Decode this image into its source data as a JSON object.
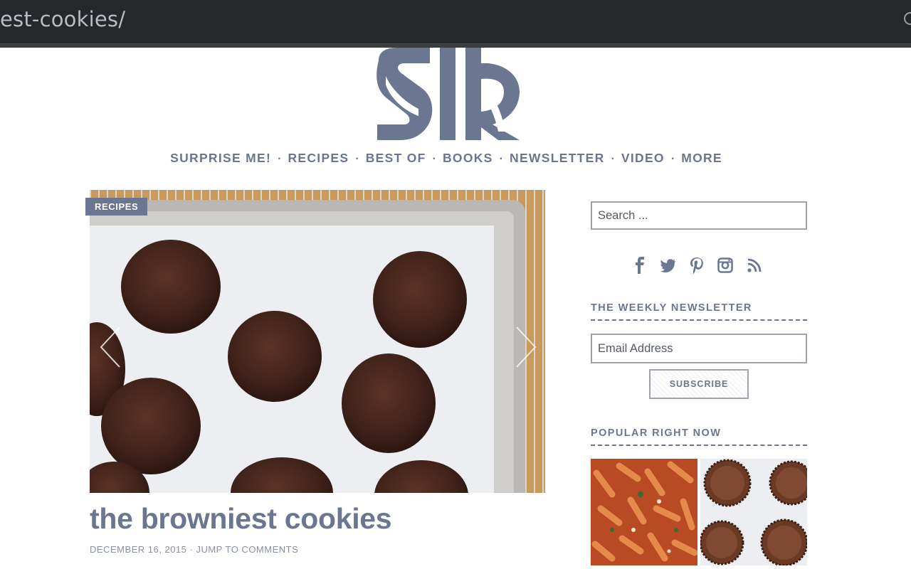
{
  "browser": {
    "url_fragment": "est-cookies/"
  },
  "nav": {
    "items": [
      "SURPRISE ME!",
      "RECIPES",
      "BEST OF",
      "BOOKS",
      "NEWSLETTER",
      "VIDEO",
      "MORE"
    ],
    "separator": "·"
  },
  "hero": {
    "category_badge": "RECIPES",
    "title": "the browniest cookies",
    "date": "DECEMBER 16, 2015",
    "meta_separator": " · ",
    "comments_link": "JUMP TO COMMENTS",
    "slider_prev_icon": "chevron-left-icon",
    "slider_next_icon": "chevron-right-icon"
  },
  "sidebar": {
    "search_placeholder": "Search ...",
    "social_icons": [
      "facebook-icon",
      "twitter-icon",
      "pinterest-icon",
      "instagram-icon",
      "rss-icon"
    ],
    "newsletter_title": "THE WEEKLY NEWSLETTER",
    "email_placeholder": "Email Address",
    "subscribe_label": "SUBSCRIBE",
    "popular_title": "POPULAR RIGHT NOW"
  },
  "colors": {
    "brand": "#6b7690",
    "browser_bar": "#26272a",
    "meta_text": "#8a8f9c"
  }
}
